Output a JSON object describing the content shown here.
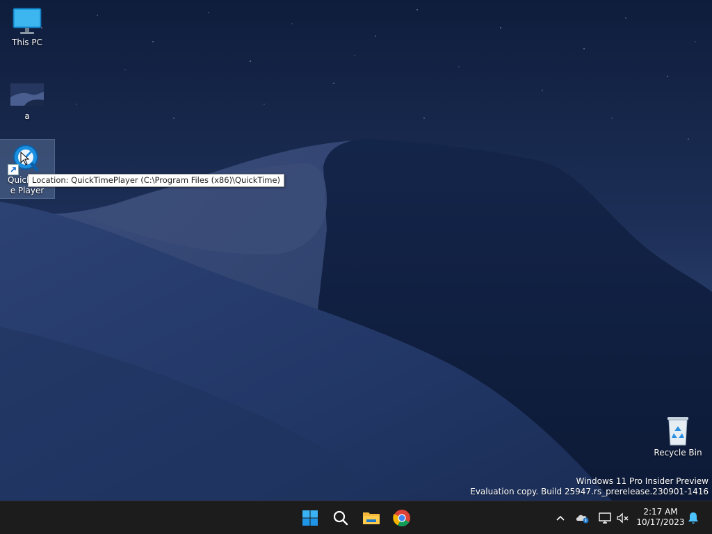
{
  "desktop": {
    "icons": [
      {
        "name": "this-pc",
        "label": "This PC"
      },
      {
        "name": "a",
        "label": "a"
      },
      {
        "name": "quicktime-player",
        "label": "QuickTime Player"
      },
      {
        "name": "recycle-bin",
        "label": "Recycle Bin"
      }
    ],
    "tooltip": "Location: QuickTimePlayer (C:\\Program Files (x86)\\QuickTime)",
    "watermark": {
      "line1": "Windows 11 Pro Insider Preview",
      "line2": "Evaluation copy. Build 25947.rs_prerelease.230901-1416"
    }
  },
  "taskbar": {
    "apps": [
      {
        "name": "start",
        "icon": "windows-logo-icon"
      },
      {
        "name": "search",
        "icon": "search-icon"
      },
      {
        "name": "file-explorer",
        "icon": "folder-icon"
      },
      {
        "name": "chrome",
        "icon": "chrome-icon"
      }
    ],
    "tray": {
      "icons": [
        "chevron-up-icon",
        "onedrive-icon",
        "network-icon",
        "volume-muted-icon",
        "notification-bell-icon"
      ]
    },
    "clock": {
      "time": "2:17 AM",
      "date": "10/17/2023"
    }
  },
  "colors": {
    "taskbar_bg": "#1c1c1c",
    "accent": "#0078d4",
    "sky": "#1b2d55",
    "dune_shadow": "#10203f"
  }
}
